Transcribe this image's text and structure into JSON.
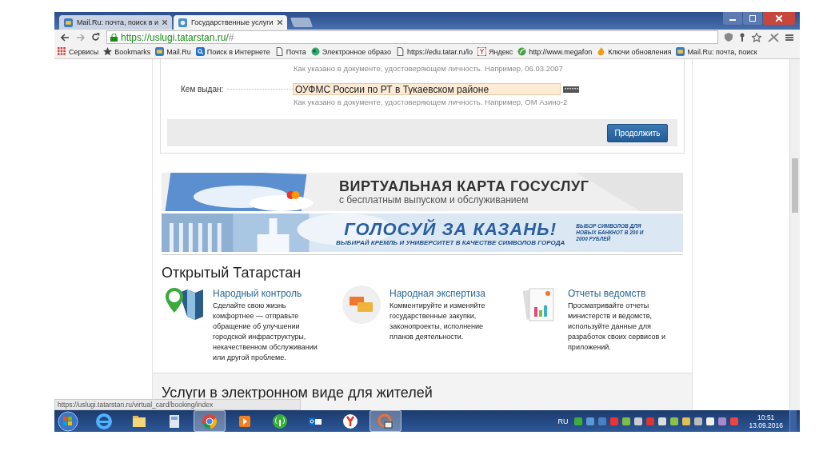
{
  "browser": {
    "tabs": [
      {
        "title": "Mail.Ru: почта, поиск в и",
        "kind": "mail",
        "selected": false
      },
      {
        "title": "Государственные услуги",
        "kind": "gov",
        "selected": true
      }
    ],
    "url_host": "https://uslugi.tatarstan.ru/",
    "url_path": "#",
    "bookmarks": [
      {
        "kind": "apps",
        "label": "Сервисы"
      },
      {
        "kind": "star",
        "label": "Bookmarks"
      },
      {
        "kind": "mail",
        "label": "Mail.Ru"
      },
      {
        "kind": "search",
        "label": "Поиск в Интернете"
      },
      {
        "kind": "doc",
        "label": "Почта"
      },
      {
        "kind": "globe",
        "label": "Электронное образо"
      },
      {
        "kind": "doc",
        "label": "https://edu.tatar.ru/lo"
      },
      {
        "kind": "yandex",
        "label": "Яндекс"
      },
      {
        "kind": "leaf",
        "label": "http://www.megafon"
      },
      {
        "kind": "flame",
        "label": "Ключи обновления"
      },
      {
        "kind": "mail",
        "label": "Mail.Ru: почта, поиск"
      }
    ],
    "status_url": "https://uslugi.tatarstan.ru/virtual_card/booking/index"
  },
  "form": {
    "previous_hint": "Как указано в документе, удостоверяющем личность. Например, 06.03.2007",
    "field": {
      "label": "Кем выдан:",
      "value": "ОУФМС России по РТ в Тукаевском районе",
      "hint": "Как указано в документе, удостоверяющем личность. Например, ОМ Азино-2"
    },
    "submit": "Продолжить"
  },
  "banners": [
    {
      "kind": "card",
      "title": "ВИРТУАЛЬНАЯ КАРТА ГОСУСЛУГ",
      "subtitle": "с бесплатным выпуском и обслуживанием"
    },
    {
      "kind": "vote",
      "title": "ГОЛОСУЙ ЗА КАЗАНЬ!",
      "subtitle": "ВЫБИРАЙ КРЕМЛЬ И УНИВЕРСИТЕТ В КАЧЕСТВЕ СИМВОЛОВ ГОРОДА",
      "side": "ВЫБОР СИМВОЛОВ ДЛЯ НОВЫХ БАНКНОТ В 200 И 2000 РУБЛЕЙ"
    }
  ],
  "open_tatarstan": {
    "heading": "Открытый Татарстан",
    "items": [
      {
        "kind": "map",
        "title": "Народный контроль",
        "text": "Сделайте свою жизнь комфортнее — отправьте обращение об улучшении городской инфраструктуры, некачественном обслуживании или другой проблеме."
      },
      {
        "kind": "chat",
        "title": "Народная экспертиза",
        "text": "Комментируйте и изменяйте государственные закупки, законопроекты, исполнение планов деятельности."
      },
      {
        "kind": "report",
        "title": "Отчеты ведомств",
        "text": "Просматривайте отчеты министерств и ведомств, используйте данные для разработок своих сервисов и приложений."
      }
    ]
  },
  "services_heading": "Услуги в электронном виде для жителей",
  "taskbar": {
    "apps": [
      {
        "kind": "ie",
        "selected": false
      },
      {
        "kind": "folder",
        "selected": false
      },
      {
        "kind": "calc",
        "selected": false
      },
      {
        "kind": "chrome",
        "selected": true
      },
      {
        "kind": "player",
        "selected": false
      },
      {
        "kind": "signal",
        "selected": false
      },
      {
        "kind": "outlook",
        "selected": false
      },
      {
        "kind": "yandex",
        "selected": false
      },
      {
        "kind": "mailer",
        "selected": true
      }
    ],
    "language": "RU",
    "time": "10:51",
    "date": "13.09.2016"
  }
}
